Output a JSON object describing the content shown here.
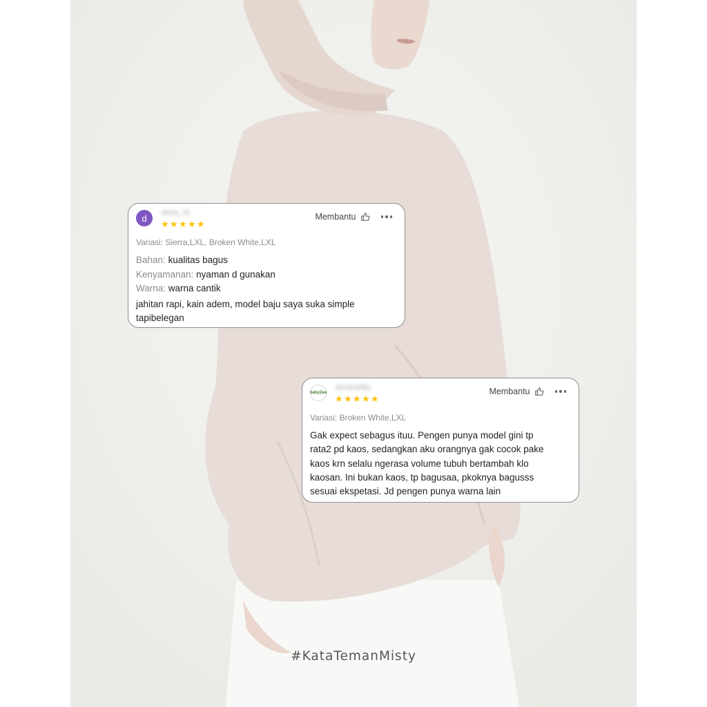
{
  "reviews": [
    {
      "avatar_letter": "d",
      "username": "dinna_16",
      "rating": 5,
      "helpful_label": "Membantu",
      "variation": "Variasi: Sierra,LXL, Broken White,LXL",
      "attributes": [
        {
          "key": "Bahan:",
          "value": "kualitas bagus"
        },
        {
          "key": "Kenyamanan:",
          "value": "nyaman d gunakan"
        },
        {
          "key": "Warna:",
          "value": "warna cantik"
        }
      ],
      "text_lines": [
        "jahitan rapi, kain adem, model baju saya suka simple",
        "tapibelegan"
      ]
    },
    {
      "avatar_letter": "babyZee",
      "username": "devanishka",
      "rating": 5,
      "helpful_label": "Membantu",
      "variation": "Variasi: Broken White,LXL",
      "text_lines": [
        "Gak expect sebagus ituu. Pengen punya model gini tp",
        "rata2 pd kaos, sedangkan aku orangnya gak cocok pake",
        "kaos krn selalu ngerasa volume tubuh bertambah klo",
        "kaosan. Ini bukan kaos, tp bagusaa, pkoknya bagusss",
        "sesuai ekspetasi. Jd pengen punya warna lain"
      ]
    }
  ],
  "hashtag": "#KataTemanMisty",
  "colors": {
    "star": "#ffc107",
    "avatar": "#7e57c2",
    "card_border": "#8c8c8c",
    "background": "#efefec"
  },
  "icons": [
    "thumb-up-icon",
    "more-options-icon",
    "star-icon"
  ]
}
